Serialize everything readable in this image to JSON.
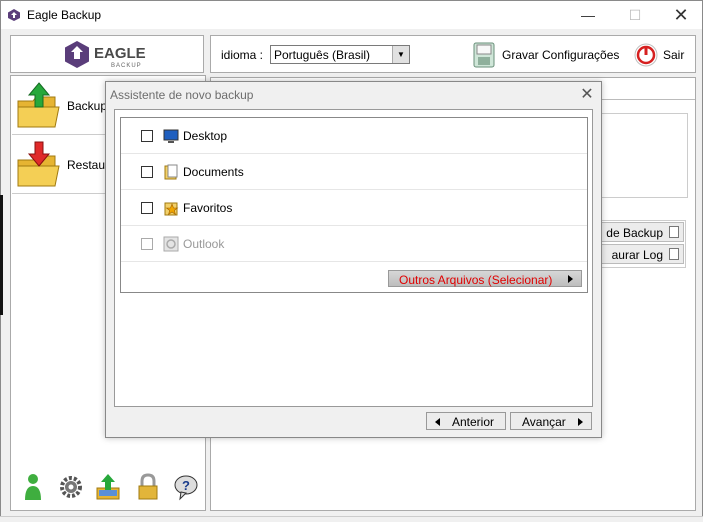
{
  "window": {
    "title": "Eagle Backup",
    "minimize": "—",
    "maximize": "☐",
    "close": "✕"
  },
  "logo": {
    "text": "EAGLE",
    "subtext": "BACKUP"
  },
  "sidebar": {
    "items": [
      {
        "label": "Backup",
        "icon": "folder-upload-icon"
      },
      {
        "label": "Restaurar",
        "icon": "folder-download-icon"
      }
    ],
    "bottom_icons": [
      "user-icon",
      "gear-icon",
      "upload-icon",
      "lock-icon",
      "help-icon"
    ]
  },
  "toolbar": {
    "language_label": "idioma :",
    "language_value": "Português (Brasil)",
    "save_label": "Gravar Configurações",
    "exit_label": "Sair"
  },
  "main": {
    "side_buttons": [
      "de Backup",
      "aurar Log"
    ]
  },
  "dialog": {
    "title": "Assistente de novo backup",
    "items": [
      {
        "label": "Desktop",
        "icon": "desktop-icon",
        "checked": false,
        "enabled": true
      },
      {
        "label": "Documents",
        "icon": "documents-icon",
        "checked": false,
        "enabled": true
      },
      {
        "label": "Favoritos",
        "icon": "favorites-icon",
        "checked": false,
        "enabled": true
      },
      {
        "label": "Outlook",
        "icon": "outlook-icon",
        "checked": false,
        "enabled": false
      }
    ],
    "other_files_label": "Outros Arquivos (Selecionar)",
    "back_label": "Anterior",
    "next_label": "Avançar"
  },
  "colors": {
    "accent_red": "#e00000",
    "logo_purple": "#5a3d7a",
    "background": "#f0f0f0"
  }
}
